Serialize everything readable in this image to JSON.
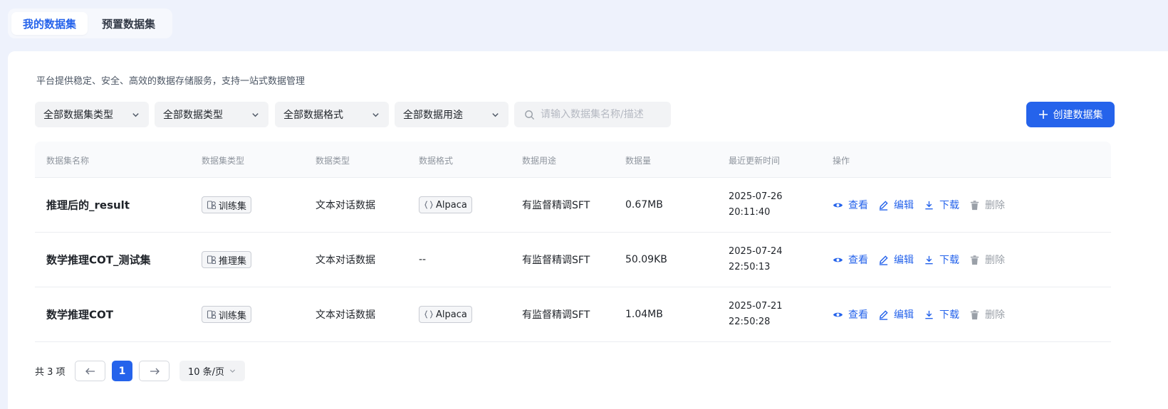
{
  "tabs": [
    {
      "label": "我的数据集",
      "active": true
    },
    {
      "label": "预置数据集",
      "active": false
    }
  ],
  "description": "平台提供稳定、安全、高效的数据存储服务，支持一站式数据管理",
  "filters": [
    {
      "selected": "全部数据集类型"
    },
    {
      "selected": "全部数据类型"
    },
    {
      "selected": "全部数据格式"
    },
    {
      "selected": "全部数据用途"
    }
  ],
  "search": {
    "value": "",
    "placeholder": "请输入数据集名称/描述"
  },
  "create_button": {
    "label": "创建数据集",
    "icon": "plus-icon"
  },
  "table": {
    "columns": [
      "数据集名称",
      "数据集类型",
      "数据类型",
      "数据格式",
      "数据用途",
      "数据量",
      "最近更新时间",
      "操作"
    ],
    "rows": [
      {
        "name": "推理后的_result",
        "set_type": "训练集",
        "data_type": "文本对话数据",
        "format": "Alpaca",
        "usage": "有监督精调SFT",
        "size": "0.67MB",
        "date": "2025-07-26",
        "time": "20:11:40"
      },
      {
        "name": "数学推理COT_测试集",
        "set_type": "推理集",
        "data_type": "文本对话数据",
        "format": "--",
        "usage": "有监督精调SFT",
        "size": "50.09KB",
        "date": "2025-07-24",
        "time": "22:50:13"
      },
      {
        "name": "数学推理COT",
        "set_type": "训练集",
        "data_type": "文本对话数据",
        "format": "Alpaca",
        "usage": "有监督精调SFT",
        "size": "1.04MB",
        "date": "2025-07-21",
        "time": "22:50:28"
      }
    ],
    "actions": {
      "view": "查看",
      "edit": "编辑",
      "download": "下载",
      "delete": "删除"
    }
  },
  "pagination": {
    "total": "共 3 项",
    "current_page": "1",
    "page_size": "10 条/页"
  },
  "colors": {
    "primary": "#2563eb",
    "muted": "#9aa0a8",
    "background": "#eef2fc",
    "filter_bg": "#f2f3f5"
  }
}
